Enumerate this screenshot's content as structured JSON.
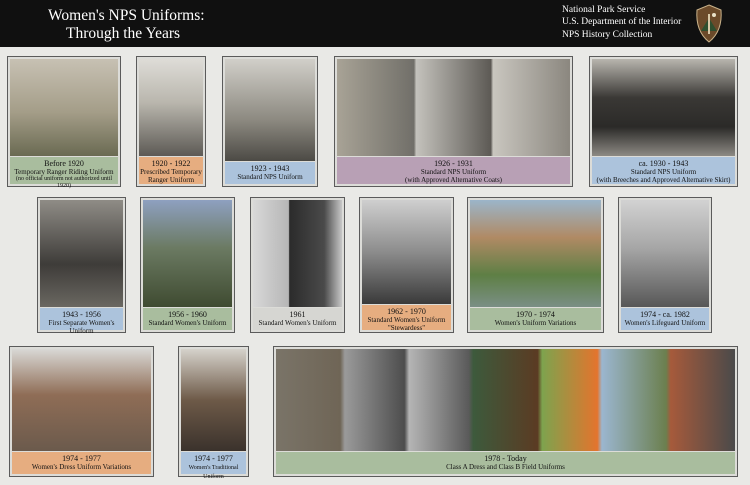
{
  "header": {
    "title_line1": "Women's NPS Uniforms:",
    "title_line2": "Through the Years",
    "org_line1": "National Park Service",
    "org_line2": "U.S. Department of the Interior",
    "collection": "NPS History Collection"
  },
  "cards": [
    {
      "date": "Before 1920",
      "lines": [
        "Temporary Ranger Riding Uniform"
      ],
      "small": "(no official uniform not authorized until 1920)"
    },
    {
      "date": "1920 - 1922",
      "lines": [
        "Prescribed Temporary",
        "Ranger Uniform"
      ]
    },
    {
      "date": "1923 - 1943",
      "lines": [
        "Standard NPS Uniform"
      ]
    },
    {
      "date": "1926 - 1931",
      "lines": [
        "Standard NPS Uniform"
      ],
      "small": "(with Approved Alternative Coats)"
    },
    {
      "date": "ca. 1930 - 1943",
      "lines": [
        "Standard NPS Uniform"
      ],
      "small": "(with Breeches and Approved Alternative Skirt)"
    },
    {
      "date": "1943 - 1956",
      "lines": [
        "First Separate Women's Uniform"
      ]
    },
    {
      "date": "1956 - 1960",
      "lines": [
        "Standard Women's Uniform"
      ]
    },
    {
      "date": "1961",
      "lines": [
        "Standard Women's Uniform"
      ]
    },
    {
      "date": "1962 - 1970",
      "lines": [
        "Standard Women's Uniform",
        "\"Stewardess\""
      ]
    },
    {
      "date": "1970 - 1974",
      "lines": [
        "Women's Uniform Variations"
      ]
    },
    {
      "date": "1974 - ca. 1982",
      "lines": [
        "Women's Lifeguard Uniform"
      ]
    },
    {
      "date": "1974 - 1977",
      "lines": [
        "Women's Dress Uniform Variations"
      ]
    },
    {
      "date": "1974 - 1977",
      "lines": [
        "Women's Traditional Uniform"
      ]
    },
    {
      "date": "1978 - Today",
      "lines": [
        "Class A Dress and Class B Field Uniforms"
      ]
    }
  ],
  "colors": {
    "green": "#a9bd9e",
    "orange": "#e6ad80",
    "blue": "#acc3dc",
    "mauve": "#b8a0b5"
  }
}
